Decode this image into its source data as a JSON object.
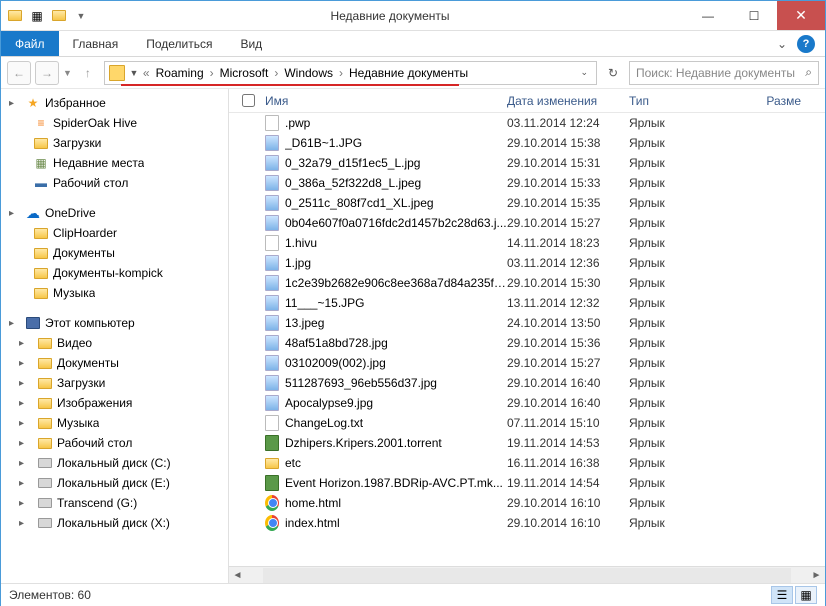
{
  "window": {
    "title": "Недавние документы"
  },
  "tabs": {
    "file": "Файл",
    "home": "Главная",
    "share": "Поделиться",
    "view": "Вид"
  },
  "breadcrumbs": [
    "Roaming",
    "Microsoft",
    "Windows",
    "Недавние документы"
  ],
  "search": {
    "placeholder": "Поиск: Недавние документы"
  },
  "sidebar": {
    "favorites": {
      "label": "Избранное",
      "items": [
        "SpiderOak Hive",
        "Загрузки",
        "Недавние места",
        "Рабочий стол"
      ]
    },
    "onedrive": {
      "label": "OneDrive",
      "items": [
        "ClipHoarder",
        "Документы",
        "Документы-kompick",
        "Музыка"
      ]
    },
    "thispc": {
      "label": "Этот компьютер",
      "items": [
        "Видео",
        "Документы",
        "Загрузки",
        "Изображения",
        "Музыка",
        "Рабочий стол",
        "Локальный диск (C:)",
        "Локальный диск (E:)",
        "Transcend (G:)",
        "Локальный диск (X:)"
      ]
    }
  },
  "columns": {
    "name": "Имя",
    "date": "Дата изменения",
    "type": "Тип",
    "size": "Разме"
  },
  "files": [
    {
      "icon": "txt",
      "name": ".pwp",
      "date": "03.11.2014 12:24",
      "type": "Ярлык"
    },
    {
      "icon": "img",
      "name": "_D61B~1.JPG",
      "date": "29.10.2014 15:38",
      "type": "Ярлык"
    },
    {
      "icon": "img",
      "name": "0_32a79_d15f1ec5_L.jpg",
      "date": "29.10.2014 15:31",
      "type": "Ярлык"
    },
    {
      "icon": "img",
      "name": "0_386a_52f322d8_L.jpeg",
      "date": "29.10.2014 15:33",
      "type": "Ярлык"
    },
    {
      "icon": "img",
      "name": "0_2511c_808f7cd1_XL.jpeg",
      "date": "29.10.2014 15:35",
      "type": "Ярлык"
    },
    {
      "icon": "img",
      "name": "0b04e607f0a0716fdc2d1457b2c28d63.j...",
      "date": "29.10.2014 15:27",
      "type": "Ярлык"
    },
    {
      "icon": "txt",
      "name": "1.hivu",
      "date": "14.11.2014 18:23",
      "type": "Ярлык"
    },
    {
      "icon": "img",
      "name": "1.jpg",
      "date": "03.11.2014 12:36",
      "type": "Ярлык"
    },
    {
      "icon": "img",
      "name": "1c2e39b2682e906c8ee368a7d84a235f_f...",
      "date": "29.10.2014 15:30",
      "type": "Ярлык"
    },
    {
      "icon": "img",
      "name": "11___~15.JPG",
      "date": "13.11.2014 12:32",
      "type": "Ярлык"
    },
    {
      "icon": "img",
      "name": "13.jpeg",
      "date": "24.10.2014 13:50",
      "type": "Ярлык"
    },
    {
      "icon": "img",
      "name": "48af51a8bd728.jpg",
      "date": "29.10.2014 15:36",
      "type": "Ярлык"
    },
    {
      "icon": "img",
      "name": "03102009(002).jpg",
      "date": "29.10.2014 15:27",
      "type": "Ярлык"
    },
    {
      "icon": "img",
      "name": "511287693_96eb556d37.jpg",
      "date": "29.10.2014 16:40",
      "type": "Ярлык"
    },
    {
      "icon": "img",
      "name": "Apocalypse9.jpg",
      "date": "29.10.2014 16:40",
      "type": "Ярлык"
    },
    {
      "icon": "txt",
      "name": "ChangeLog.txt",
      "date": "07.11.2014 15:10",
      "type": "Ярлык"
    },
    {
      "icon": "torrent",
      "name": "Dzhipers.Kripers.2001.torrent",
      "date": "19.11.2014 14:53",
      "type": "Ярлык"
    },
    {
      "icon": "folder",
      "name": "etc",
      "date": "16.11.2014 16:38",
      "type": "Ярлык"
    },
    {
      "icon": "torrent",
      "name": "Event Horizon.1987.BDRip-AVC.PT.mk...",
      "date": "19.11.2014 14:54",
      "type": "Ярлык"
    },
    {
      "icon": "chrome",
      "name": "home.html",
      "date": "29.10.2014 16:10",
      "type": "Ярлык"
    },
    {
      "icon": "chrome",
      "name": "index.html",
      "date": "29.10.2014 16:10",
      "type": "Ярлык"
    }
  ],
  "status": {
    "count_label": "Элементов:",
    "count": "60"
  }
}
